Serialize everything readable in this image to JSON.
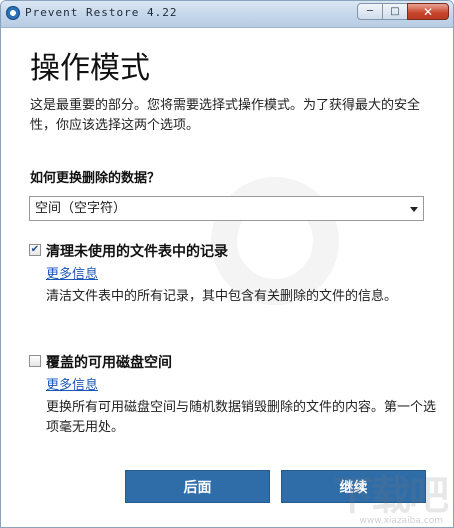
{
  "window": {
    "title": "Prevent Restore 4.22",
    "controls": {
      "minimize": "─",
      "maximize": "□",
      "close": "✕"
    }
  },
  "page": {
    "heading": "操作模式",
    "intro": "这是最重要的部分。您将需要选择式操作模式。为了获得最大的安全性，你应该选择这两个选项。"
  },
  "question": "如何更换删除的数据？",
  "dropdown": {
    "selected": "空间（空字符）"
  },
  "options": [
    {
      "checked": true,
      "check_glyph": "✔",
      "title": "清理未使用的文件表中的记录",
      "more_link": "更多信息",
      "description": "清洁文件表中的所有记录，其中包含有关删除的文件的信息。"
    },
    {
      "checked": false,
      "check_glyph": "",
      "title": "覆盖的可用磁盘空间",
      "more_link": "更多信息",
      "description": "更换所有可用磁盘空间与随机数据销毁删除的文件的内容。第一个选项毫无用处。"
    }
  ],
  "buttons": {
    "back": "后面",
    "continue": "继续"
  },
  "watermark": {
    "text": "下载吧",
    "sub": "www.xiazaiba.com"
  },
  "colors": {
    "button_bg": "#2f6da8",
    "link": "#1a56b8",
    "close_button": "#c8442b"
  }
}
